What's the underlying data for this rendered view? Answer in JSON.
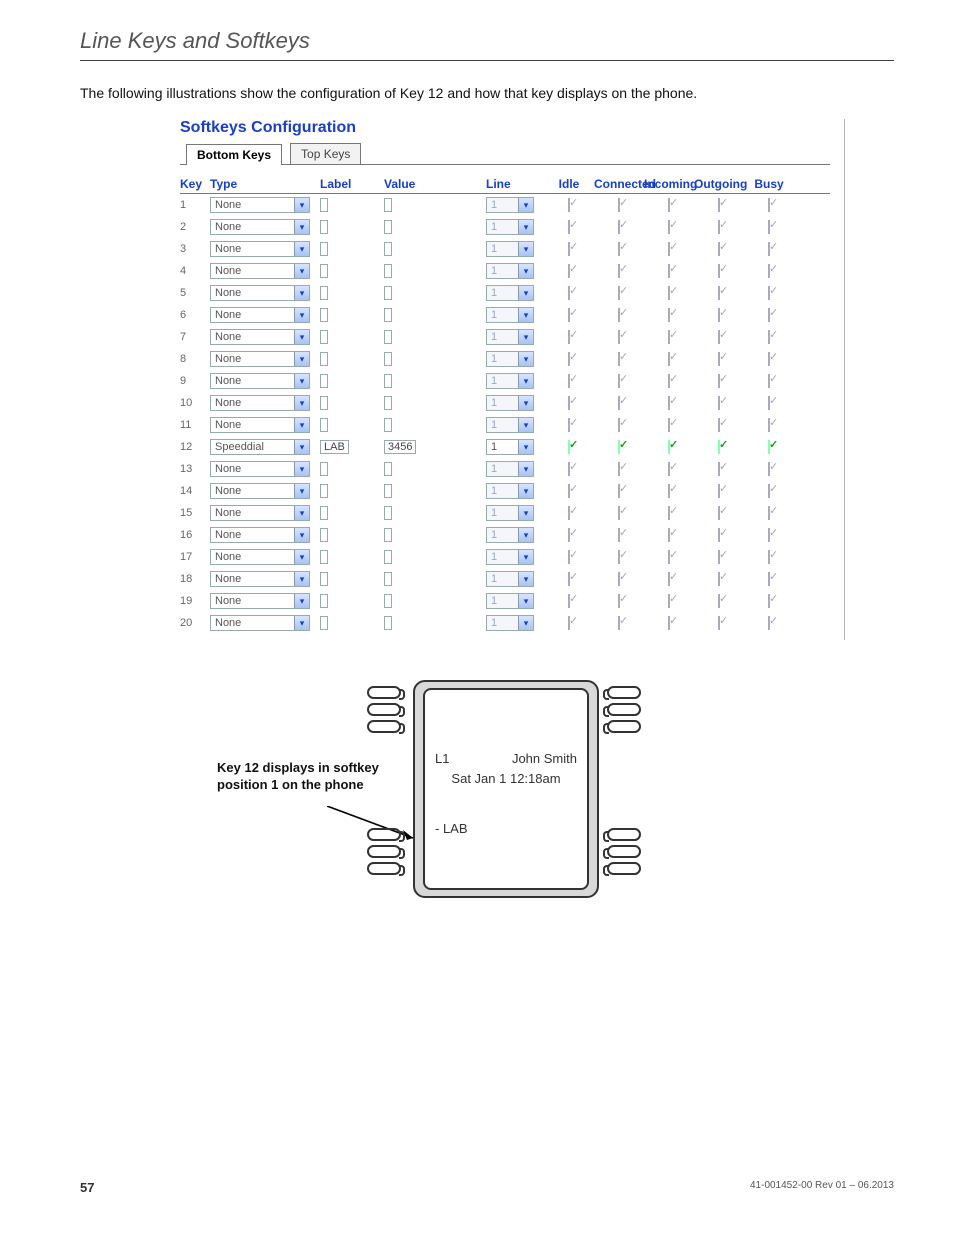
{
  "header": {
    "title": "Line Keys and Softkeys"
  },
  "intro": "The following illustrations show the configuration of Key 12 and how that key displays on the phone.",
  "config": {
    "title": "Softkeys Configuration",
    "tabs": {
      "active": "Bottom Keys",
      "inactive": "Top Keys"
    },
    "columns": {
      "key": "Key",
      "type": "Type",
      "label": "Label",
      "value": "Value",
      "line": "Line",
      "idle": "Idle",
      "connected": "Connected",
      "incoming": "Incoming",
      "outgoing": "Outgoing",
      "busy": "Busy"
    },
    "rows": [
      {
        "key": "1",
        "type": "None",
        "label": "",
        "value": "",
        "line": "1",
        "active": false
      },
      {
        "key": "2",
        "type": "None",
        "label": "",
        "value": "",
        "line": "1",
        "active": false
      },
      {
        "key": "3",
        "type": "None",
        "label": "",
        "value": "",
        "line": "1",
        "active": false
      },
      {
        "key": "4",
        "type": "None",
        "label": "",
        "value": "",
        "line": "1",
        "active": false
      },
      {
        "key": "5",
        "type": "None",
        "label": "",
        "value": "",
        "line": "1",
        "active": false
      },
      {
        "key": "6",
        "type": "None",
        "label": "",
        "value": "",
        "line": "1",
        "active": false
      },
      {
        "key": "7",
        "type": "None",
        "label": "",
        "value": "",
        "line": "1",
        "active": false
      },
      {
        "key": "8",
        "type": "None",
        "label": "",
        "value": "",
        "line": "1",
        "active": false
      },
      {
        "key": "9",
        "type": "None",
        "label": "",
        "value": "",
        "line": "1",
        "active": false
      },
      {
        "key": "10",
        "type": "None",
        "label": "",
        "value": "",
        "line": "1",
        "active": false
      },
      {
        "key": "11",
        "type": "None",
        "label": "",
        "value": "",
        "line": "1",
        "active": false
      },
      {
        "key": "12",
        "type": "Speeddial",
        "label": "LAB",
        "value": "3456",
        "line": "1",
        "active": true
      },
      {
        "key": "13",
        "type": "None",
        "label": "",
        "value": "",
        "line": "1",
        "active": false
      },
      {
        "key": "14",
        "type": "None",
        "label": "",
        "value": "",
        "line": "1",
        "active": false
      },
      {
        "key": "15",
        "type": "None",
        "label": "",
        "value": "",
        "line": "1",
        "active": false
      },
      {
        "key": "16",
        "type": "None",
        "label": "",
        "value": "",
        "line": "1",
        "active": false
      },
      {
        "key": "17",
        "type": "None",
        "label": "",
        "value": "",
        "line": "1",
        "active": false
      },
      {
        "key": "18",
        "type": "None",
        "label": "",
        "value": "",
        "line": "1",
        "active": false
      },
      {
        "key": "19",
        "type": "None",
        "label": "",
        "value": "",
        "line": "1",
        "active": false
      },
      {
        "key": "20",
        "type": "None",
        "label": "",
        "value": "",
        "line": "1",
        "active": false
      }
    ]
  },
  "phone": {
    "callout": "Key 12 displays in softkey position 1 on the phone",
    "line_label": "L1",
    "name": "John Smith",
    "datetime": "Sat  Jan 1  12:18am",
    "softkey1": "- LAB"
  },
  "footer": {
    "pageno": "57",
    "docrev": "41-001452-00 Rev 01 – 06.2013"
  }
}
